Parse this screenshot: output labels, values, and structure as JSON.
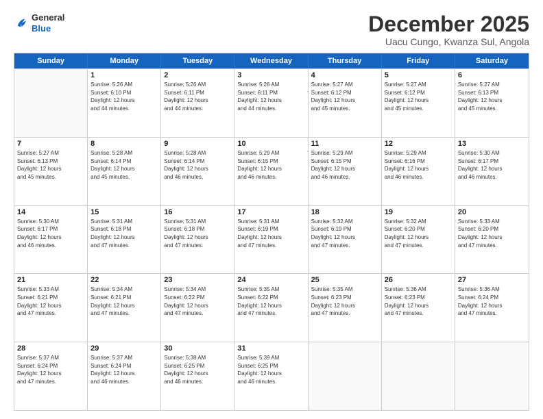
{
  "header": {
    "logo_general": "General",
    "logo_blue": "Blue",
    "month_title": "December 2025",
    "location": "Uacu Cungo, Kwanza Sul, Angola"
  },
  "days_of_week": [
    "Sunday",
    "Monday",
    "Tuesday",
    "Wednesday",
    "Thursday",
    "Friday",
    "Saturday"
  ],
  "weeks": [
    [
      {
        "day": "",
        "info": ""
      },
      {
        "day": "1",
        "info": "Sunrise: 5:26 AM\nSunset: 6:10 PM\nDaylight: 12 hours\nand 44 minutes."
      },
      {
        "day": "2",
        "info": "Sunrise: 5:26 AM\nSunset: 6:11 PM\nDaylight: 12 hours\nand 44 minutes."
      },
      {
        "day": "3",
        "info": "Sunrise: 5:26 AM\nSunset: 6:11 PM\nDaylight: 12 hours\nand 44 minutes."
      },
      {
        "day": "4",
        "info": "Sunrise: 5:27 AM\nSunset: 6:12 PM\nDaylight: 12 hours\nand 45 minutes."
      },
      {
        "day": "5",
        "info": "Sunrise: 5:27 AM\nSunset: 6:12 PM\nDaylight: 12 hours\nand 45 minutes."
      },
      {
        "day": "6",
        "info": "Sunrise: 5:27 AM\nSunset: 6:13 PM\nDaylight: 12 hours\nand 45 minutes."
      }
    ],
    [
      {
        "day": "7",
        "info": "Sunrise: 5:27 AM\nSunset: 6:13 PM\nDaylight: 12 hours\nand 45 minutes."
      },
      {
        "day": "8",
        "info": "Sunrise: 5:28 AM\nSunset: 6:14 PM\nDaylight: 12 hours\nand 45 minutes."
      },
      {
        "day": "9",
        "info": "Sunrise: 5:28 AM\nSunset: 6:14 PM\nDaylight: 12 hours\nand 46 minutes."
      },
      {
        "day": "10",
        "info": "Sunrise: 5:29 AM\nSunset: 6:15 PM\nDaylight: 12 hours\nand 46 minutes."
      },
      {
        "day": "11",
        "info": "Sunrise: 5:29 AM\nSunset: 6:15 PM\nDaylight: 12 hours\nand 46 minutes."
      },
      {
        "day": "12",
        "info": "Sunrise: 5:29 AM\nSunset: 6:16 PM\nDaylight: 12 hours\nand 46 minutes."
      },
      {
        "day": "13",
        "info": "Sunrise: 5:30 AM\nSunset: 6:17 PM\nDaylight: 12 hours\nand 46 minutes."
      }
    ],
    [
      {
        "day": "14",
        "info": "Sunrise: 5:30 AM\nSunset: 6:17 PM\nDaylight: 12 hours\nand 46 minutes."
      },
      {
        "day": "15",
        "info": "Sunrise: 5:31 AM\nSunset: 6:18 PM\nDaylight: 12 hours\nand 47 minutes."
      },
      {
        "day": "16",
        "info": "Sunrise: 5:31 AM\nSunset: 6:18 PM\nDaylight: 12 hours\nand 47 minutes."
      },
      {
        "day": "17",
        "info": "Sunrise: 5:31 AM\nSunset: 6:19 PM\nDaylight: 12 hours\nand 47 minutes."
      },
      {
        "day": "18",
        "info": "Sunrise: 5:32 AM\nSunset: 6:19 PM\nDaylight: 12 hours\nand 47 minutes."
      },
      {
        "day": "19",
        "info": "Sunrise: 5:32 AM\nSunset: 6:20 PM\nDaylight: 12 hours\nand 47 minutes."
      },
      {
        "day": "20",
        "info": "Sunrise: 5:33 AM\nSunset: 6:20 PM\nDaylight: 12 hours\nand 47 minutes."
      }
    ],
    [
      {
        "day": "21",
        "info": "Sunrise: 5:33 AM\nSunset: 6:21 PM\nDaylight: 12 hours\nand 47 minutes."
      },
      {
        "day": "22",
        "info": "Sunrise: 5:34 AM\nSunset: 6:21 PM\nDaylight: 12 hours\nand 47 minutes."
      },
      {
        "day": "23",
        "info": "Sunrise: 5:34 AM\nSunset: 6:22 PM\nDaylight: 12 hours\nand 47 minutes."
      },
      {
        "day": "24",
        "info": "Sunrise: 5:35 AM\nSunset: 6:22 PM\nDaylight: 12 hours\nand 47 minutes."
      },
      {
        "day": "25",
        "info": "Sunrise: 5:35 AM\nSunset: 6:23 PM\nDaylight: 12 hours\nand 47 minutes."
      },
      {
        "day": "26",
        "info": "Sunrise: 5:36 AM\nSunset: 6:23 PM\nDaylight: 12 hours\nand 47 minutes."
      },
      {
        "day": "27",
        "info": "Sunrise: 5:36 AM\nSunset: 6:24 PM\nDaylight: 12 hours\nand 47 minutes."
      }
    ],
    [
      {
        "day": "28",
        "info": "Sunrise: 5:37 AM\nSunset: 6:24 PM\nDaylight: 12 hours\nand 47 minutes."
      },
      {
        "day": "29",
        "info": "Sunrise: 5:37 AM\nSunset: 6:24 PM\nDaylight: 12 hours\nand 46 minutes."
      },
      {
        "day": "30",
        "info": "Sunrise: 5:38 AM\nSunset: 6:25 PM\nDaylight: 12 hours\nand 46 minutes."
      },
      {
        "day": "31",
        "info": "Sunrise: 5:39 AM\nSunset: 6:25 PM\nDaylight: 12 hours\nand 46 minutes."
      },
      {
        "day": "",
        "info": ""
      },
      {
        "day": "",
        "info": ""
      },
      {
        "day": "",
        "info": ""
      }
    ]
  ]
}
